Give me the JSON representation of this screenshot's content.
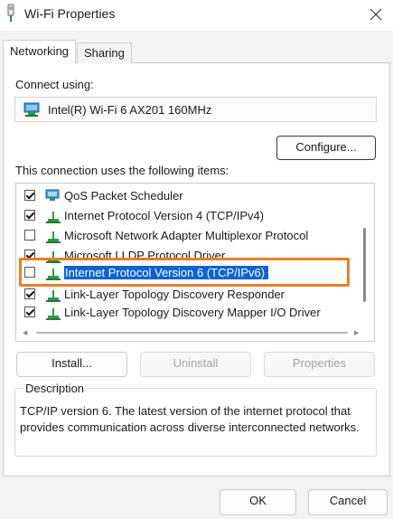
{
  "window": {
    "title": "Wi-Fi Properties"
  },
  "tabs": [
    {
      "label": "Networking",
      "active": true
    },
    {
      "label": "Sharing",
      "active": false
    }
  ],
  "connect": {
    "label": "Connect using:",
    "adapter": "Intel(R) Wi-Fi 6 AX201 160MHz",
    "configure_label": "Configure..."
  },
  "items_section": {
    "label": "This connection uses the following items:",
    "items": [
      {
        "label": "QoS Packet Scheduler",
        "checked": true,
        "icon": "scheduler-icon"
      },
      {
        "label": "Internet Protocol Version 4 (TCP/IPv4)",
        "checked": true,
        "icon": "protocol-icon"
      },
      {
        "label": "Microsoft Network Adapter Multiplexor Protocol",
        "checked": false,
        "icon": "protocol-icon"
      },
      {
        "label": "Microsoft LLDP Protocol Driver",
        "checked": true,
        "icon": "protocol-icon"
      },
      {
        "label": "Internet Protocol Version 6 (TCP/IPv6)",
        "checked": false,
        "icon": "protocol-icon",
        "selected": true
      },
      {
        "label": "Link-Layer Topology Discovery Responder",
        "checked": true,
        "icon": "protocol-icon"
      },
      {
        "label": "Link-Layer Topology Discovery Mapper I/O Driver",
        "checked": true,
        "icon": "protocol-icon"
      }
    ]
  },
  "buttons": {
    "install": "Install...",
    "uninstall": "Uninstall",
    "properties": "Properties",
    "ok": "OK",
    "cancel": "Cancel"
  },
  "description": {
    "title": "Description",
    "text": "TCP/IP version 6. The latest version of the internet protocol that provides communication across diverse interconnected networks."
  },
  "colors": {
    "selection": "#0a64d8",
    "highlight_outline": "#ef7d22"
  }
}
